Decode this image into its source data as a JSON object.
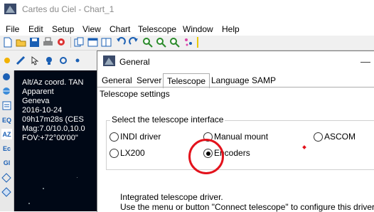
{
  "window": {
    "title": "Cartes du Ciel - Chart_1"
  },
  "menu": [
    "File",
    "Edit",
    "Setup",
    "View",
    "Chart",
    "Telescope",
    "Window",
    "Help"
  ],
  "chart_info": [
    "Alt/Az coord. TAN",
    "Apparent",
    "Geneva",
    "2016-10-24",
    "09h17m28s (CES",
    "Mag:7.0/10.0,10.0",
    "FOV:+72°00'00\""
  ],
  "left_toolbar": [
    "EQ",
    "AZ",
    "Ec",
    "Gl"
  ],
  "dialog": {
    "title": "General",
    "tabs": [
      "General",
      "Server",
      "Telescope",
      "Language",
      "SAMP"
    ],
    "active_tab": "Telescope",
    "section_label": "Telescope settings",
    "group_label": "Select the telescope interface",
    "options": {
      "indi": "INDI driver",
      "manual": "Manual mount",
      "ascom": "ASCOM",
      "lx200": "LX200",
      "encoders": "Encoders"
    },
    "selected": "Encoders",
    "info_line1": "Integrated telescope driver.",
    "info_line2": "Use the menu or button \"Connect telescope\" to configure this driver."
  },
  "colors": {
    "highlight": "#e3121c",
    "chart_bg": "#000816"
  }
}
